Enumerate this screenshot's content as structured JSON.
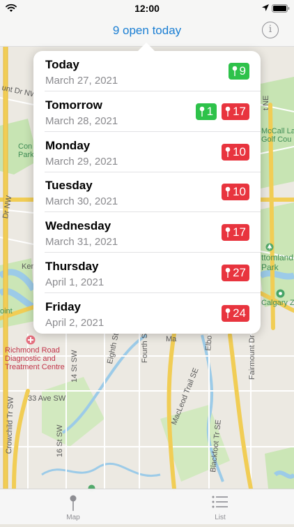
{
  "status_bar": {
    "time": "12:00",
    "icons": [
      "wifi-icon",
      "location-arrow-icon",
      "battery-icon"
    ]
  },
  "nav": {
    "title": "9 open today",
    "info_icon": "info-icon",
    "info_glyph": "i"
  },
  "days": [
    {
      "name": "Today",
      "date": "March 27, 2021",
      "badges": [
        {
          "color": "green",
          "count": "9"
        }
      ]
    },
    {
      "name": "Tomorrow",
      "date": "March 28, 2021",
      "badges": [
        {
          "color": "green",
          "count": "1"
        },
        {
          "color": "red",
          "count": "17"
        }
      ]
    },
    {
      "name": "Monday",
      "date": "March 29, 2021",
      "badges": [
        {
          "color": "red",
          "count": "10"
        }
      ]
    },
    {
      "name": "Tuesday",
      "date": "March 30, 2021",
      "badges": [
        {
          "color": "red",
          "count": "10"
        }
      ]
    },
    {
      "name": "Wednesday",
      "date": "March 31, 2021",
      "badges": [
        {
          "color": "red",
          "count": "17"
        }
      ]
    },
    {
      "name": "Thursday",
      "date": "April 1, 2021",
      "badges": [
        {
          "color": "red",
          "count": "27"
        }
      ]
    },
    {
      "name": "Friday",
      "date": "April 2, 2021",
      "badges": [
        {
          "color": "red",
          "count": "24"
        }
      ]
    }
  ],
  "map_labels": {
    "l1": "unt Dr NW",
    "l2": "Con",
    "l3": "Park",
    "l4": "Dr NW",
    "l5": "Ken",
    "l6": "oint",
    "l7": "Richmond Road",
    "l8": "Diagnostic and",
    "l9": "Treatment Centre",
    "l10": "14 St SW",
    "l11": "Eighth St",
    "l12": "Fourth St",
    "l13": "Ma",
    "l14": "Elbo",
    "l15": "Fairmount Dr SE",
    "l16": "MacLeod Trail SE",
    "l17": "33 Ave SW",
    "l18": "16 St SW",
    "l19": "Crowchild Tr SW",
    "l20": "Blackfoot Tr SE",
    "l21": "McCall La",
    "l22": "Golf Cou",
    "l23": "ttomland",
    "l24": "Park",
    "l25": "Calgary Zo",
    "l26": "t NE"
  },
  "tabs": [
    {
      "label": "Map",
      "icon": "map-pin-icon"
    },
    {
      "label": "List",
      "icon": "list-icon"
    }
  ],
  "colors": {
    "accent": "#1a7ed3",
    "badge_green": "#2ec24a",
    "badge_red": "#e8343e",
    "water": "#a6d0ec",
    "park": "#c6e5b0",
    "highway": "#f2cf5c"
  }
}
